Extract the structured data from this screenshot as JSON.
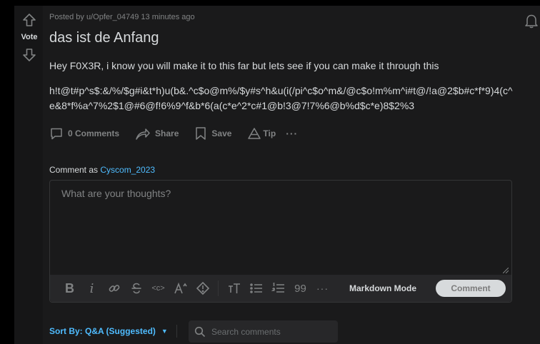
{
  "post": {
    "meta": "Posted by u/Opfer_04749 13 minutes ago",
    "title": "das ist de Anfang",
    "body_line1": "Hey F0X3R, i know you will make it to this far but lets see if you can make it through this",
    "body_line2": "h!t@t#p^s$:&/%/$g#i&t*h)u(b&.^c$o@m%/$y#s^h&u(i(/pi^c$o^m&/@c$o!m%m^i#t@/!a@2$b#c*f*9)4(c^e&8*f%a^7%2$1@#6@f!6%9^f&b*6(a(c*e^2*c#1@b!3@7!7%6@b%d$c*e)8$2%3"
  },
  "vote": {
    "label": "Vote"
  },
  "actions": {
    "comments": "0 Comments",
    "share": "Share",
    "save": "Save",
    "tip": "Tip",
    "more": "···"
  },
  "comment_box": {
    "label": "Comment as ",
    "username": "Cyscom_2023",
    "placeholder": "What are your thoughts?",
    "markdown_mode": "Markdown Mode",
    "submit": "Comment"
  },
  "toolbar": {
    "bold": "B",
    "italic": "i",
    "more": "···",
    "quote": "99",
    "code": "<c>"
  },
  "sort": {
    "label": "Sort By: Q&A (Suggested)",
    "caret": "▼"
  },
  "search": {
    "placeholder": "Search comments"
  },
  "colors": {
    "background": "#1a1a1b",
    "link": "#4fbcff",
    "muted": "#818384",
    "text": "#d7dadc"
  }
}
